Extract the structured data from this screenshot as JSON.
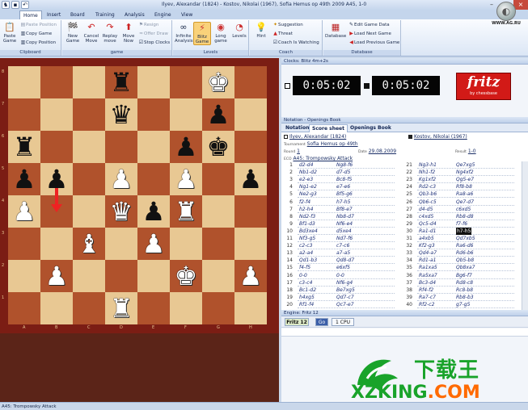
{
  "window": {
    "title": "Ilyev, Alexandar (1824) - Kostov, Nikolai (1967), Sofia Hemus op 49th 2009  A45, 1-0",
    "controls": [
      "–",
      "□",
      "×"
    ]
  },
  "ribbon_tabs": [
    "Home",
    "Insert",
    "Board",
    "Training",
    "Analysis",
    "Engine",
    "View"
  ],
  "ribbon": {
    "clipboard": {
      "paste": "Paste\nGame",
      "paste_position": "Paste Position",
      "copy_game": "Copy Game",
      "copy_position": "Copy Position",
      "label": "Clipboard"
    },
    "game": {
      "new_game": "New\nGame",
      "cancel_move": "Cancel\nMove",
      "replay_move": "Replay\nmove",
      "move_now": "Move\nNow",
      "resign": "Resign",
      "offer_draw": "Offer Draw",
      "stop_clocks": "Stop Clocks",
      "label": "game"
    },
    "levels": {
      "infinite_analysis": "Infinite\nAnalysis",
      "blitz_game": "Blitz\nGame",
      "long_game": "Long\ngame",
      "levels": "Levels",
      "label": "Levels"
    },
    "coach": {
      "hint": "Hint",
      "suggestion": "Suggestion",
      "threat": "Threat",
      "coach_watching": "Coach Is Watching",
      "label": "Coach"
    },
    "database": {
      "database": "Database",
      "edit_game_data": "Edit Game Data",
      "load_next": "Load Next Game",
      "load_previous": "Load Previous Game",
      "label": "Database"
    }
  },
  "site_logo": {
    "url": "WWW.AG.RU"
  },
  "board": {
    "ranks": [
      "8",
      "7",
      "6",
      "5",
      "4",
      "3",
      "2",
      "1"
    ],
    "files": [
      "A",
      "B",
      "C",
      "D",
      "E",
      "F",
      "G",
      "H"
    ],
    "position": [
      [
        "",
        "",
        "",
        "bR",
        "",
        "",
        "wK",
        ""
      ],
      [
        "",
        "",
        "",
        "bQ",
        "",
        "",
        "bP",
        ""
      ],
      [
        "bR",
        "",
        "",
        "",
        "",
        "bP",
        "bK",
        ""
      ],
      [
        "bP",
        "bP",
        "",
        "wP",
        "",
        "wP",
        "",
        "bP"
      ],
      [
        "wP",
        "",
        "",
        "wQ",
        "bP",
        "wR",
        "",
        ""
      ],
      [
        "",
        "",
        "wB",
        "",
        "wP",
        "",
        "",
        ""
      ],
      [
        "",
        "wP",
        "",
        "",
        "",
        "wK",
        "",
        "wP"
      ],
      [
        "",
        "",
        "",
        "wR",
        "",
        "",
        "",
        ""
      ]
    ]
  },
  "clocks": {
    "title": "Clocks: Blitz 4m+2s",
    "white_time": "0:05:02",
    "black_time": "0:05:02",
    "brand": "fritz",
    "brand_sub": "by chessbase"
  },
  "notation": {
    "title": "Notation - Openings Book",
    "tabs": [
      "Notation",
      "Score sheet",
      "Openings Book"
    ],
    "white_player": "Ilyev, Alexandar (1824)",
    "black_player": "Kostov, Nikolai (1967)",
    "tournament_label": "Tournament",
    "tournament": "Sofia Hemus op 49th",
    "round_label": "Round",
    "round": "1",
    "date_label": "Date",
    "date": "29.08.2009",
    "result_label": "Result",
    "result": "1-0",
    "eco_label": "ECO",
    "eco": "A45: Trompowsky Attack",
    "moves_left": [
      [
        "1",
        "d2-d4",
        "Ng8-f6"
      ],
      [
        "2",
        "Nb1-d2",
        "d7-d5"
      ],
      [
        "3",
        "e2-e3",
        "Bc8-f5"
      ],
      [
        "4",
        "Ng1-e2",
        "e7-e6"
      ],
      [
        "5",
        "Ne2-g3",
        "Bf5-g6"
      ],
      [
        "6",
        "f2-f4",
        "h7-h5"
      ],
      [
        "7",
        "h2-h4",
        "Bf8-e7"
      ],
      [
        "8",
        "Nd2-f3",
        "Nb8-d7"
      ],
      [
        "9",
        "Bf1-d3",
        "Nf6-e4"
      ],
      [
        "10",
        "Bd3xe4",
        "d5xe4"
      ],
      [
        "11",
        "Nf3-g5",
        "Nd7-f6"
      ],
      [
        "12",
        "c2-c3",
        "c7-c6"
      ],
      [
        "13",
        "a2-a4",
        "a7-a5"
      ],
      [
        "14",
        "Qd1-b3",
        "Qd8-d7"
      ],
      [
        "15",
        "f4-f5",
        "e6xf5"
      ],
      [
        "16",
        "0-0",
        "0-0"
      ],
      [
        "17",
        "c3-c4",
        "Nf6-g4"
      ],
      [
        "18",
        "Bc1-d2",
        "Be7xg5"
      ],
      [
        "19",
        "h4xg5",
        "Qd7-c7"
      ],
      [
        "20",
        "Rf1-f4",
        "Qc7-e7"
      ]
    ],
    "moves_right": [
      [
        "21",
        "Ng3-h1",
        "Qe7xg5"
      ],
      [
        "22",
        "Nh1-f2",
        "Ng4xf2"
      ],
      [
        "23",
        "Kg1xf2",
        "Qg5-e7"
      ],
      [
        "24",
        "Rd2-c3",
        "Rf8-b8"
      ],
      [
        "25",
        "Qb3-b6",
        "Ra8-a6"
      ],
      [
        "26",
        "Qb6-c5",
        "Qe7-d7"
      ],
      [
        "27",
        "d4-d5",
        "c6xd5"
      ],
      [
        "28",
        "c4xd5",
        "Rb8-d8"
      ],
      [
        "29",
        "Qc5-d4",
        "f7-f6"
      ],
      [
        "30",
        "Ra1-d1",
        "h7-h5"
      ],
      [
        "31",
        "a4xb5",
        "Qd7xb5"
      ],
      [
        "32",
        "Kf2-g3",
        "Ra6-d6"
      ],
      [
        "33",
        "Qd4-a7",
        "Rd6-b6"
      ],
      [
        "34",
        "Rd1-a1",
        "Qb5-b8"
      ],
      [
        "35",
        "Ra1xa5",
        "Qb8xa7"
      ],
      [
        "36",
        "Ra5xa7",
        "Bg6-f7"
      ],
      [
        "37",
        "Bc3-d4",
        "Rd8-c8"
      ],
      [
        "38",
        "Rf4-f2",
        "Rc8-b8"
      ],
      [
        "39",
        "Ra7-c7",
        "Rb8-b3"
      ],
      [
        "40",
        "Rf2-c2",
        "g7-g5"
      ]
    ],
    "highlight_move": "h7-h5",
    "footer_pawns": "♟ ♟"
  },
  "engine": {
    "title": "Engine: Fritz 12",
    "engine_name": "Fritz 12",
    "go": "Go",
    "cpu": "1 CPU"
  },
  "status_bar": "A45: Trompowsky Attack",
  "watermark": {
    "cn": "下载王",
    "url_main": "XZKING",
    "url_tld": ".COM"
  },
  "colors": {
    "light_square": "#e8c893",
    "dark_square": "#b0522c",
    "board_frame": "#7b1d14",
    "accent": "#d21a17",
    "watermark_green": "#19a32a"
  }
}
